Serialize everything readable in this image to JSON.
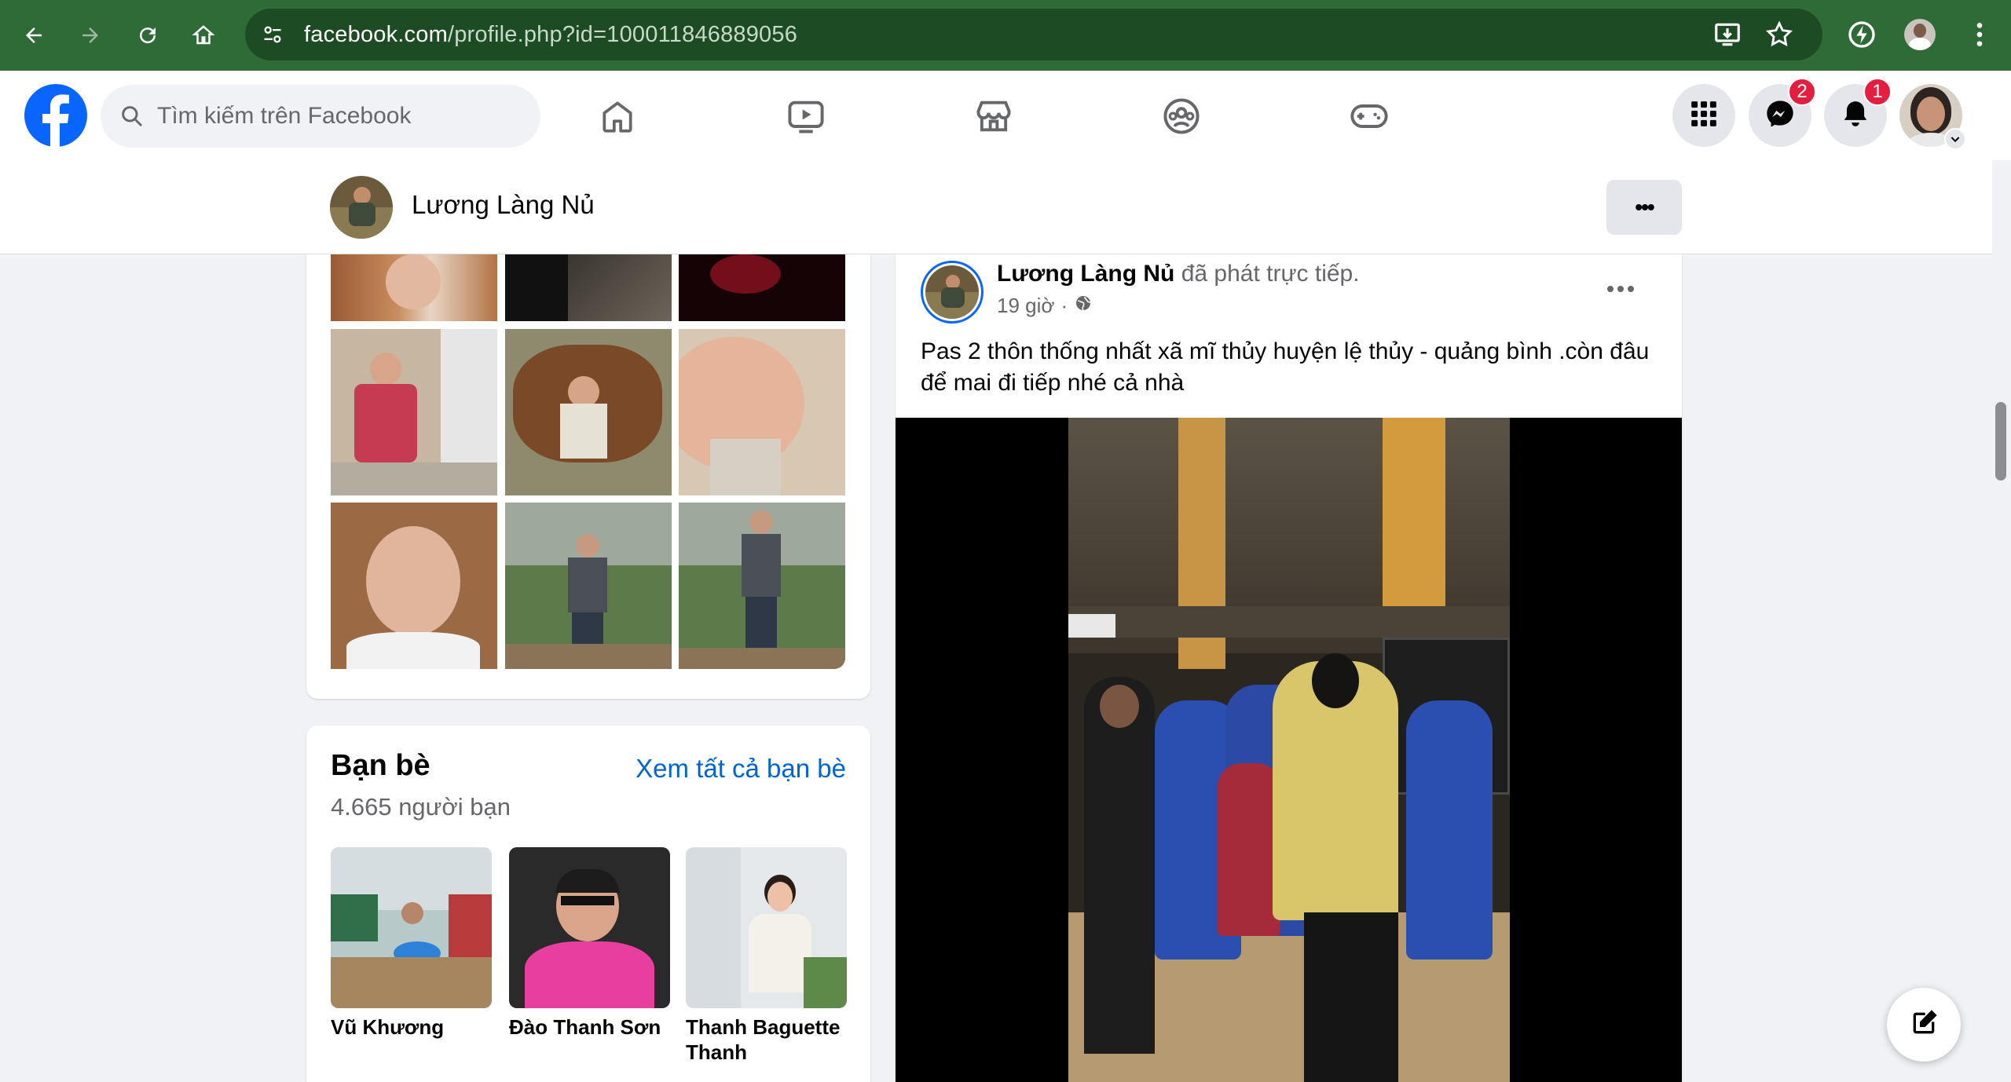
{
  "browser": {
    "url_host": "facebook.com",
    "url_path": "/profile.php?id=100011846889056"
  },
  "header": {
    "search_placeholder": "Tìm kiếm trên Facebook",
    "messenger_badge": "2",
    "notifications_badge": "1"
  },
  "profile_bar": {
    "name": "Lương Làng Nủ",
    "more_label": "•••"
  },
  "friends": {
    "title": "Bạn bè",
    "see_all": "Xem tất cả bạn bè",
    "count": "4.665 người bạn",
    "items": [
      {
        "name": "Vũ Khương"
      },
      {
        "name": "Đào Thanh Sơn"
      },
      {
        "name": "Thanh Baguette Thanh"
      }
    ]
  },
  "post": {
    "author": "Lương Làng Nủ",
    "action": "đã phát trực tiếp.",
    "time": "19 giờ",
    "separator": "·",
    "text": "Pas 2 thôn thống nhất xã mĩ thủy huyện lệ thủy - quảng bình .còn đâu để mai đi tiếp nhé cả nhà"
  },
  "colors": {
    "brand_blue": "#0866ff",
    "link_blue": "#0064d1",
    "badge_red": "#e41e3f",
    "chrome_green": "#2e6b36"
  }
}
